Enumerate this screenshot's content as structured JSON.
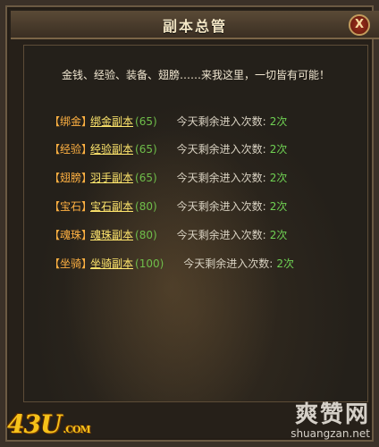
{
  "window": {
    "title": "副本总管",
    "close_glyph": "X"
  },
  "intro": "金钱、经验、装备、翅膀……来我这里，一切皆有可能！",
  "dungeons": [
    {
      "tag": "【绑金】",
      "name": "绑金副本",
      "level": "(65)",
      "remain_label": "今天剩余进入次数:",
      "count": "2次"
    },
    {
      "tag": "【经验】",
      "name": "经验副本",
      "level": "(65)",
      "remain_label": "今天剩余进入次数:",
      "count": "2次"
    },
    {
      "tag": "【翅膀】",
      "name": "羽手副本",
      "level": "(65)",
      "remain_label": "今天剩余进入次数:",
      "count": "2次"
    },
    {
      "tag": "【宝石】",
      "name": "宝石副本",
      "level": "(80)",
      "remain_label": "今天剩余进入次数:",
      "count": "2次"
    },
    {
      "tag": "【魂珠】",
      "name": "魂珠副本",
      "level": "(80)",
      "remain_label": "今天剩余进入次数:",
      "count": "2次"
    },
    {
      "tag": "【坐骑】",
      "name": "坐骑副本",
      "level": "(100)",
      "remain_label": "今天剩余进入次数:",
      "count": "2次"
    }
  ],
  "watermarks": {
    "logo_text": "43U",
    "logo_suffix": ".COM",
    "site_title": "爽赞网",
    "site_url": "shuangzan.net"
  }
}
